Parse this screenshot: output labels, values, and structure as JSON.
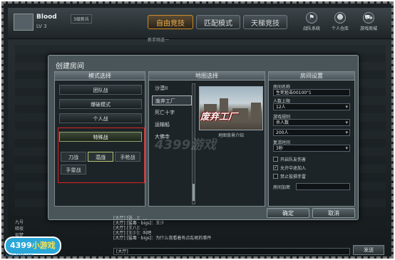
{
  "player": {
    "name": "Blood",
    "level": "LV 3",
    "tag": "3级新兵"
  },
  "top_modes": [
    {
      "label": "自由竞技",
      "active": true
    },
    {
      "label": "匹配模式",
      "active": false
    },
    {
      "label": "天梯竞技",
      "active": false
    }
  ],
  "top_icons": [
    {
      "label": "战队系统",
      "icon": "flag-icon"
    },
    {
      "label": "个人仓库",
      "icon": "person-icon"
    },
    {
      "label": "游戏商城",
      "icon": "cart-icon"
    }
  ],
  "newbie_label": "新手频道一",
  "dialog": {
    "title": "创建房间",
    "mode_column": {
      "header": "模式选择",
      "modes": [
        "团队战",
        "爆破模式",
        "个人战",
        "特殊战"
      ],
      "selected_mode": "特殊战",
      "sub_modes": [
        "刀战",
        "混战",
        "手枪战",
        "手雷战"
      ],
      "selected_sub_mode": "混战"
    },
    "map_column": {
      "header": "地图选择",
      "maps": [
        "沙漠II",
        "废弃工厂",
        "死亡十字",
        "运输船",
        "大佛寺"
      ],
      "selected_map": "废弃工厂",
      "preview_title": "废弃工厂",
      "preview_info": "地图背景介绍"
    },
    "room_column": {
      "header": "房间设置",
      "room_name_label": "房间名称",
      "room_name_value": "生死狙击00100\"1",
      "people_label": "人数上限",
      "people_value": "12人",
      "rule_label": "游戏规则",
      "rule_value": "杀人数",
      "kills_value": "200人",
      "time_label": "复活时间",
      "time_value": "3秒",
      "checks": [
        {
          "label": "开启队友伤害",
          "checked": false
        },
        {
          "label": "允许中途加入",
          "checked": true
        },
        {
          "label": "禁止投掷手雷",
          "checked": false
        }
      ],
      "password_label": "房间加密"
    },
    "ok_label": "确定",
    "cancel_label": "取消"
  },
  "chat": {
    "lines": [
      "[大厅] [张…]：…",
      "[大厅] [猛毒 · bigs]：王少",
      "[大厅] [王八]：…",
      "[大厅] [王少]：叫吧",
      "[大厅] [猛毒 · bigs]：为什么我看着有点乱呢的事件"
    ],
    "input_placeholder": "[大厅]",
    "send_label": "发送",
    "side_items": [
      "九号",
      "暗夜",
      "如梦"
    ]
  },
  "watermark": "4399游戏",
  "logo": {
    "main": "4399",
    "small": "小游戏",
    "url": "www.4399.com"
  }
}
